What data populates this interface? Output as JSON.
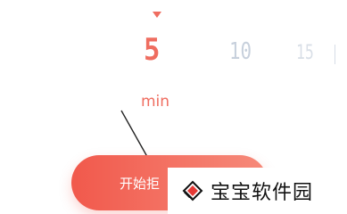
{
  "picker": {
    "values": [
      "5",
      "10",
      "15"
    ],
    "selected": "5",
    "unit": "min"
  },
  "start_button": {
    "label": "开始拒"
  },
  "watermark": {
    "text": "宝宝软件园"
  },
  "colors": {
    "accent": "#ef6d60",
    "muted": "#c7d0dc",
    "button_start": "#f1594c",
    "button_end": "#f68a7a"
  },
  "icons": [
    "triangle-down-icon",
    "arrow-pointer-icon",
    "watermark-logo-icon"
  ]
}
